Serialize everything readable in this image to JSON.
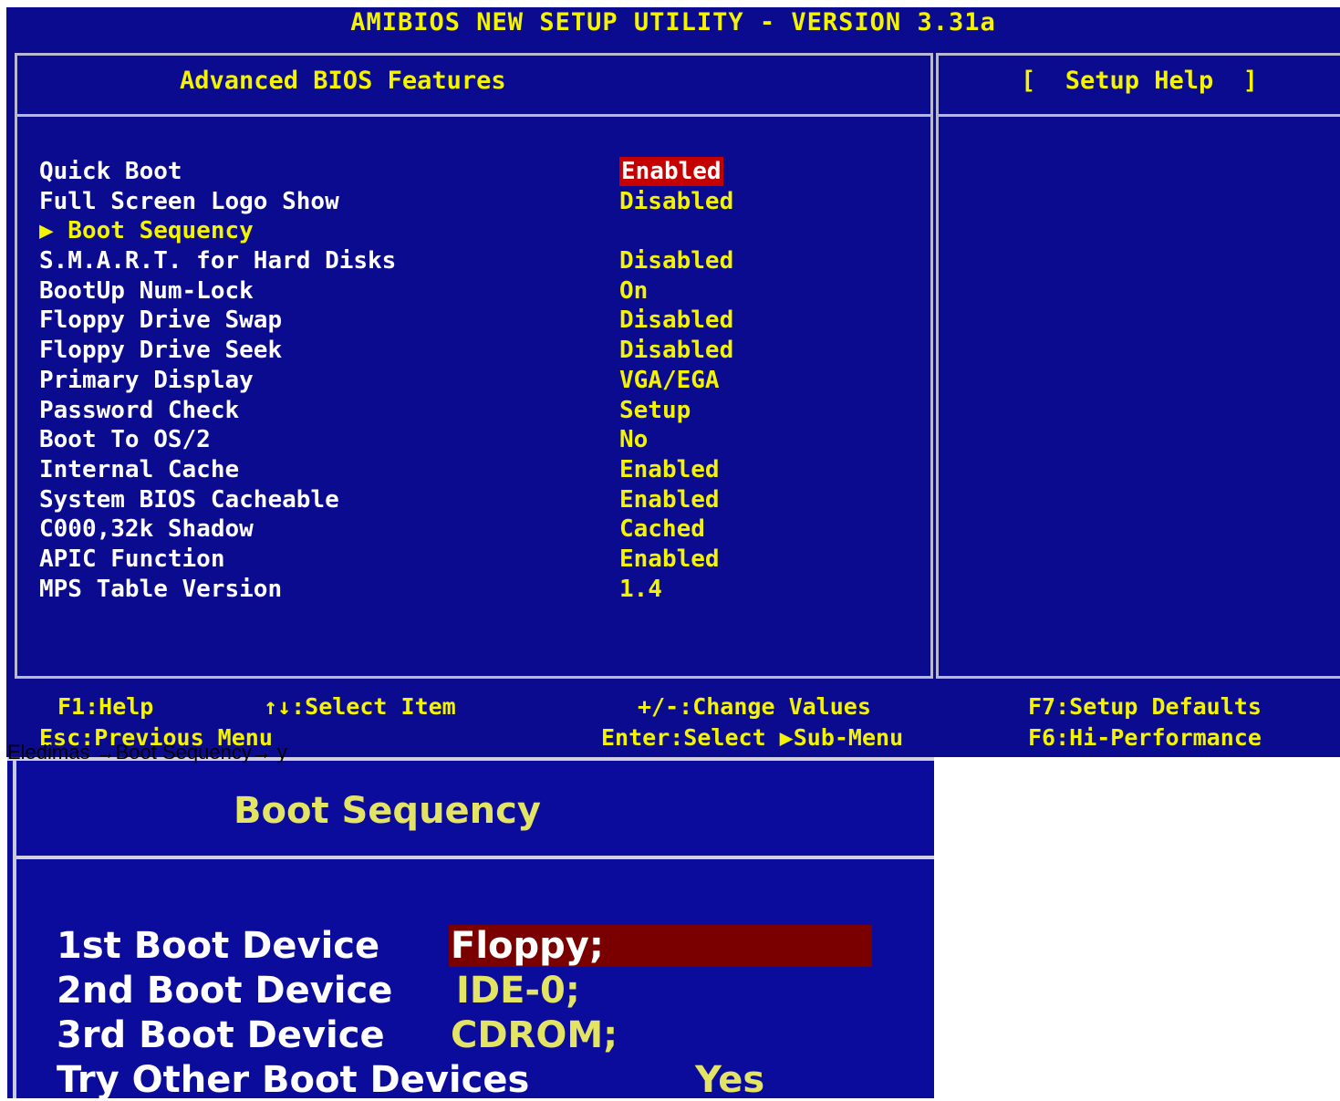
{
  "bios": {
    "title": "AMIBIOS NEW SETUP UTILITY - VERSION 3.31a",
    "panel_title": "Advanced BIOS Features",
    "help_title": "[  Setup Help  ]",
    "items": [
      {
        "label": "Quick Boot",
        "value": "Enabled",
        "selected": true
      },
      {
        "label": "Full Screen Logo Show",
        "value": "Disabled"
      },
      {
        "label": "▶ Boot Sequency",
        "value": "",
        "submenu": true
      },
      {
        "label": "S.M.A.R.T. for Hard Disks",
        "value": "Disabled"
      },
      {
        "label": "BootUp Num-Lock",
        "value": "On"
      },
      {
        "label": "Floppy Drive Swap",
        "value": "Disabled"
      },
      {
        "label": "Floppy Drive Seek",
        "value": "Disabled"
      },
      {
        "label": "Primary Display",
        "value": "VGA/EGA"
      },
      {
        "label": "Password Check",
        "value": "Setup"
      },
      {
        "label": "Boot To OS/2",
        "value": "No"
      },
      {
        "label": "Internal Cache",
        "value": "Enabled"
      },
      {
        "label": "System BIOS Cacheable",
        "value": "Enabled"
      },
      {
        "label": "C000,32k Shadow",
        "value": "Cached"
      },
      {
        "label": "APIC Function",
        "value": "Enabled"
      },
      {
        "label": "MPS Table Version",
        "value": "1.4"
      }
    ],
    "keys": {
      "f1": "F1:Help",
      "select_item": "↑↓:Select Item",
      "change_values": "+/-:Change Values",
      "f7": "F7:Setup Defaults",
      "esc": "Esc:Previous Menu",
      "enter": "Enter:Select ▶Sub-Menu",
      "f6": "F6:Hi-Performance"
    }
  },
  "caption": "Eledimas →Boot Sequency→ y",
  "boot_sequence": {
    "title": "Boot Sequency",
    "items": [
      {
        "label": "1st Boot Device",
        "value": "Floppy;",
        "selected": true
      },
      {
        "label": "2nd Boot Device",
        "value": "IDE-0;"
      },
      {
        "label": "3rd Boot Device",
        "value": "CDROM;"
      },
      {
        "label": "Try Other Boot Devices",
        "value": "Yes"
      }
    ]
  },
  "colors": {
    "bios_background": "#0b0b8f",
    "text_yellow": "#f4f400",
    "text_white": "#ffffff",
    "highlight_red": "#c40000",
    "highlight_dark_red": "#7a0000"
  }
}
